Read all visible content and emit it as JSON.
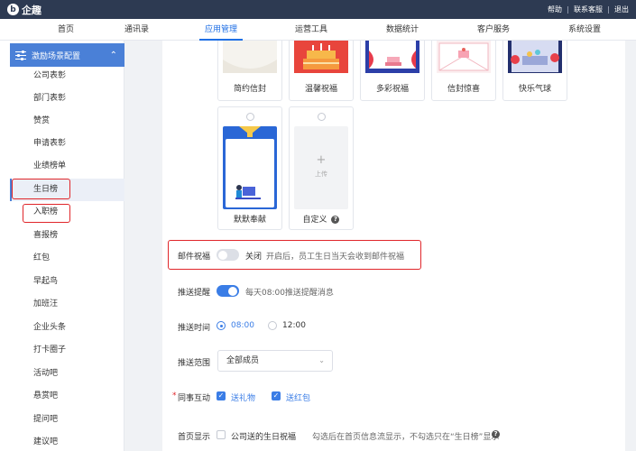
{
  "app": {
    "name": "企趣",
    "logo_letter": "b"
  },
  "toplinks": [
    "帮助",
    "联系客服",
    "退出"
  ],
  "nav": [
    "首页",
    "通讯录",
    "应用管理",
    "运营工具",
    "数据统计",
    "客户服务",
    "系统设置"
  ],
  "nav_active_index": 2,
  "sidebar": {
    "header": "激励场景配置",
    "items": [
      "公司表彰",
      "部门表彰",
      "赞赏",
      "申请表彰",
      "业绩榜单",
      "生日榜",
      "入职榜",
      "喜报榜",
      "红包",
      "早起鸟",
      "加班汪",
      "企业头条",
      "打卡圈子",
      "活动吧",
      "悬赏吧",
      "提问吧",
      "建议吧"
    ],
    "active_index": 5
  },
  "templates": {
    "row1": [
      "简约信封",
      "温馨祝福",
      "多彩祝福",
      "信封惊喜",
      "快乐气球"
    ],
    "row2": [
      "默默奉献",
      "自定义"
    ],
    "upload_label": "上传",
    "upload_plus": "+"
  },
  "settings": {
    "email": {
      "label": "邮件祝福",
      "state": "关闭",
      "hint": "开启后，员工生日当天会收到邮件祝福"
    },
    "push": {
      "label": "推送提醒",
      "hint": "每天08:00推送提醒消息"
    },
    "push_time": {
      "label": "推送时间",
      "options": [
        "08:00",
        "12:00"
      ],
      "selected": "08:00"
    },
    "scope": {
      "label": "推送范围",
      "value": "全部成员"
    },
    "interaction": {
      "label": "同事互动",
      "required_mark": "*",
      "options": [
        "送礼物",
        "送红包"
      ]
    },
    "homepage": {
      "label": "首页显示",
      "option": "公司送的生日祝福",
      "hint": "勾选后在首页信息流显示，不勾选只在“生日榜”显示"
    }
  },
  "colors": {
    "topbar": "#2d3a52",
    "accent": "#3a7de6",
    "sidebar_header": "#4a80d7",
    "highlight_box": "#e0262a"
  }
}
